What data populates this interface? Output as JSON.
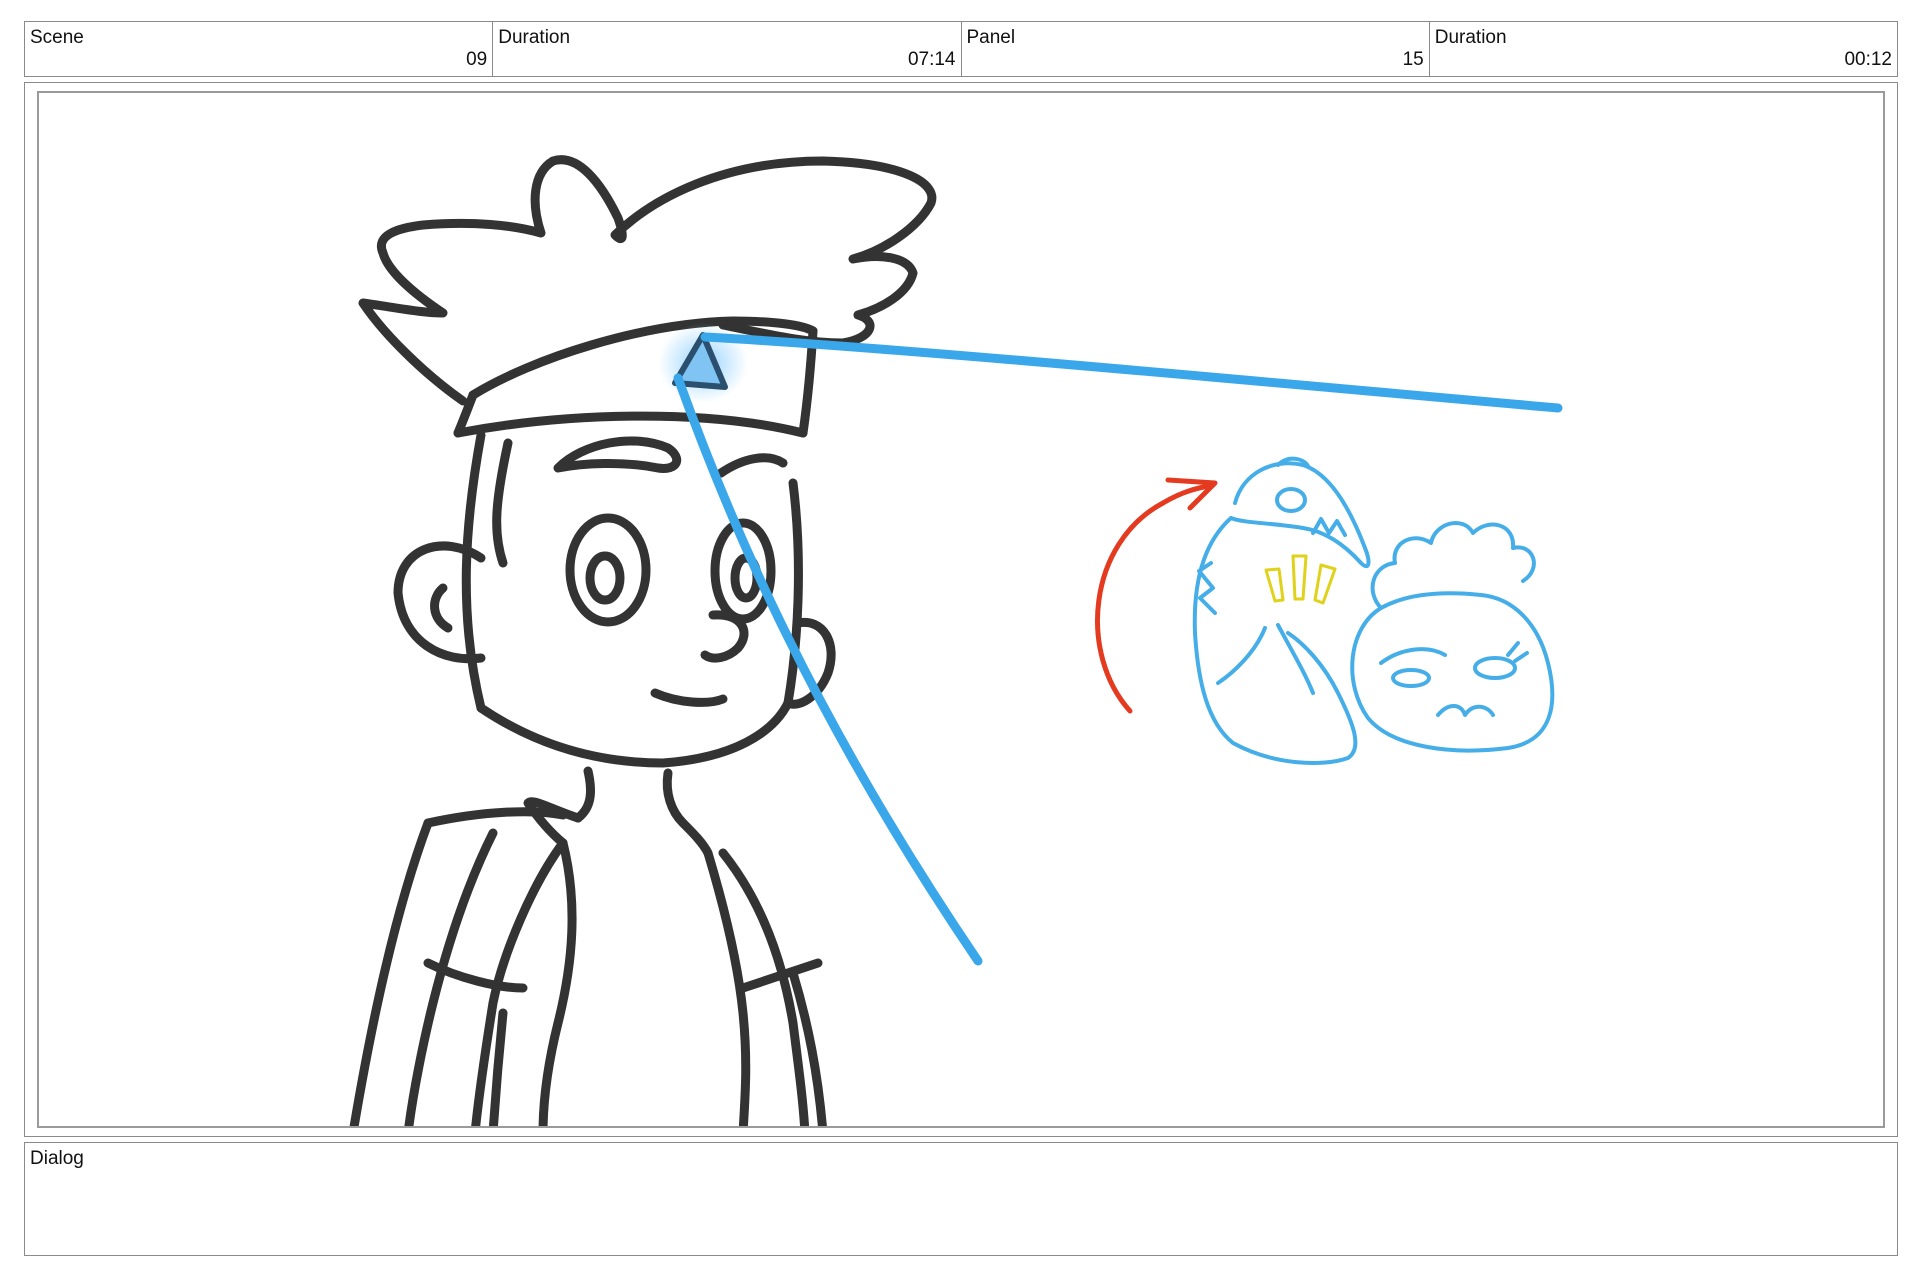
{
  "header": {
    "scene": {
      "label": "Scene",
      "value": "09"
    },
    "scene_duration": {
      "label": "Duration",
      "value": "07:14"
    },
    "panel": {
      "label": "Panel",
      "value": "15"
    },
    "panel_duration": {
      "label": "Duration",
      "value": "00:12"
    }
  },
  "dialog": {
    "label": "Dialog",
    "text": ""
  },
  "colors": {
    "ink": "#333333",
    "direction_line": "#3aa7ea",
    "sketch_blue": "#45aee8",
    "arrow_red": "#e33a20",
    "accent_yellow": "#e0d21a",
    "glow": "#8fd0ff"
  }
}
